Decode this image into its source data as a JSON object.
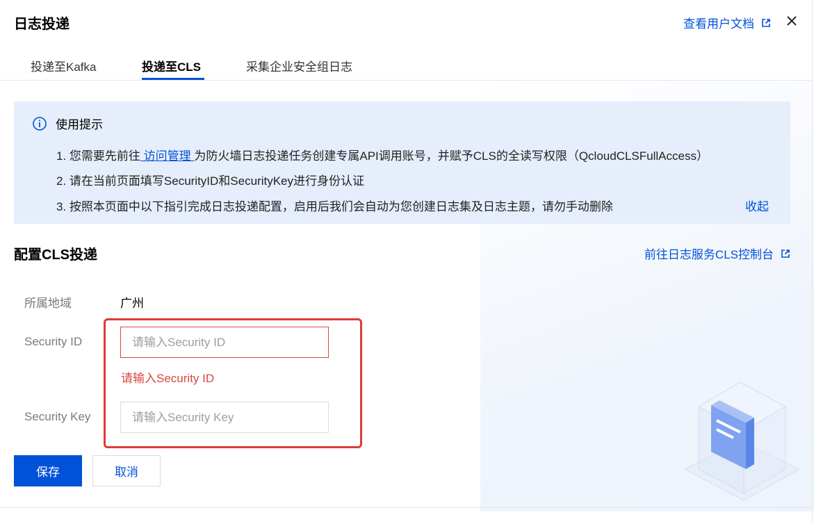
{
  "header": {
    "title": "日志投递",
    "doc_link": "查看用户文档"
  },
  "tabs": [
    {
      "label": "投递至Kafka",
      "active": false
    },
    {
      "label": "投递至CLS",
      "active": true
    },
    {
      "label": "采集企业安全组日志",
      "active": false
    }
  ],
  "tip": {
    "heading": "使用提示",
    "line1_prefix": "1. 您需要先前往",
    "line1_link": " 访问管理 ",
    "line1_suffix": "为防火墙日志投递任务创建专属API调用账号，并赋予CLS的全读写权限（QcloudCLSFullAccess）",
    "line2": "2. 请在当前页面填写SecurityID和SecurityKey进行身份认证",
    "line3": "3. 按照本页面中以下指引完成日志投递配置，启用后我们会自动为您创建日志集及日志主题，请勿手动删除",
    "collapse": "收起"
  },
  "section": {
    "title": "配置CLS投递",
    "console_link": "前往日志服务CLS控制台"
  },
  "form": {
    "region_label": "所属地域",
    "region_value": "广州",
    "security_id_label": "Security ID",
    "security_id_placeholder": "请输入Security ID",
    "security_id_value": "",
    "security_id_error": "请输入Security ID",
    "security_key_label": "Security Key",
    "security_key_placeholder": "请输入Security Key",
    "security_key_value": ""
  },
  "buttons": {
    "save": "保存",
    "cancel": "取消"
  },
  "colors": {
    "brand": "#0052d9",
    "error": "#d54941",
    "tip_bg": "#e6eefc",
    "annotation": "#e03a3a"
  },
  "icons": [
    "external-link-icon",
    "close-icon",
    "info-icon"
  ]
}
